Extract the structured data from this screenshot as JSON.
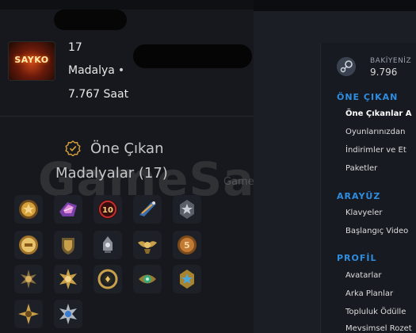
{
  "profile": {
    "avatar_text": "SAYKO",
    "stat_count": "17",
    "medal_label": "Madalya",
    "dot": "•",
    "hours": "7.767 Saat"
  },
  "medals": {
    "title_line1": "Öne Çıkan",
    "title_line2": "Madalyalar (17)",
    "count": 17
  },
  "watermark": {
    "text": "GameSatis",
    "sub": "Game Satis"
  },
  "wallet": {
    "label": "BAKİYENİZ",
    "value": "9.796"
  },
  "sections": [
    {
      "heading": "ÖNE ÇIKAN",
      "items": [
        "Öne Çıkanlar A",
        "Oyunlarınızdan",
        "İndirimler ve Et",
        "Paketler"
      ]
    },
    {
      "heading": "ARAYÜZ",
      "items": [
        "Klavyeler",
        "Başlangıç Video"
      ]
    },
    {
      "heading": "PROFİL",
      "items": [
        "Avatarlar",
        "Arka Planlar",
        "Topluluk Ödülle",
        "Mevsimsel Rozet"
      ]
    }
  ],
  "colors": {
    "accent": "#2f8de0",
    "panel": "#16181d",
    "medal_gold": "#d8a23a"
  }
}
